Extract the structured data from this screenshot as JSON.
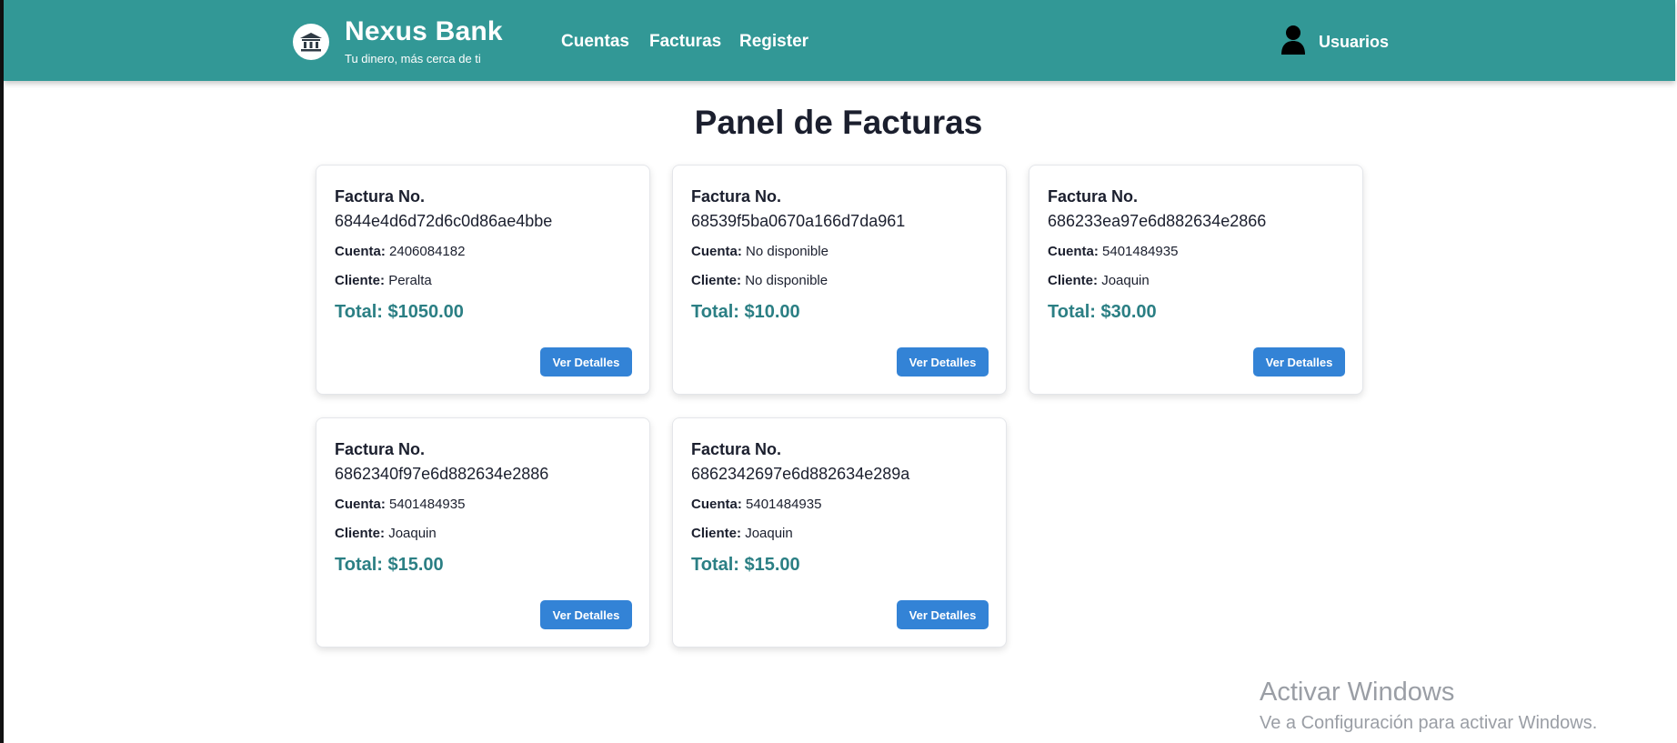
{
  "header": {
    "brand_name": "Nexus Bank",
    "tagline": "Tu dinero, más cerca de ti",
    "logo_icon": "bank-icon",
    "bg_color": "#329896",
    "nav": [
      {
        "label": "Cuentas"
      },
      {
        "label": "Facturas"
      },
      {
        "label": "Register"
      }
    ],
    "user": {
      "icon": "user-icon",
      "label": "Usuarios"
    }
  },
  "main": {
    "title": "Panel de Facturas",
    "invoice_label": "Factura No.",
    "account_label": "Cuenta:",
    "client_label": "Cliente:",
    "details_button": "Ver Detalles",
    "accent_color": "#2b7f84",
    "button_color": "#3383d6",
    "invoices": [
      {
        "id": "6844e4d6d72d6c0d86ae4bbe",
        "account": "2406084182",
        "client": "Peralta",
        "total": "Total: $1050.00"
      },
      {
        "id": "68539f5ba0670a166d7da961",
        "account": "No disponible",
        "client": "No disponible",
        "total": "Total: $10.00"
      },
      {
        "id": "686233ea97e6d882634e2866",
        "account": "5401484935",
        "client": "Joaquin",
        "total": "Total: $30.00"
      },
      {
        "id": "6862340f97e6d882634e2886",
        "account": "5401484935",
        "client": "Joaquin",
        "total": "Total: $15.00"
      },
      {
        "id": "6862342697e6d882634e289a",
        "account": "5401484935",
        "client": "Joaquin",
        "total": "Total: $15.00"
      }
    ]
  },
  "watermark": {
    "title": "Activar Windows",
    "subtitle": "Ve a Configuración para activar Windows."
  }
}
